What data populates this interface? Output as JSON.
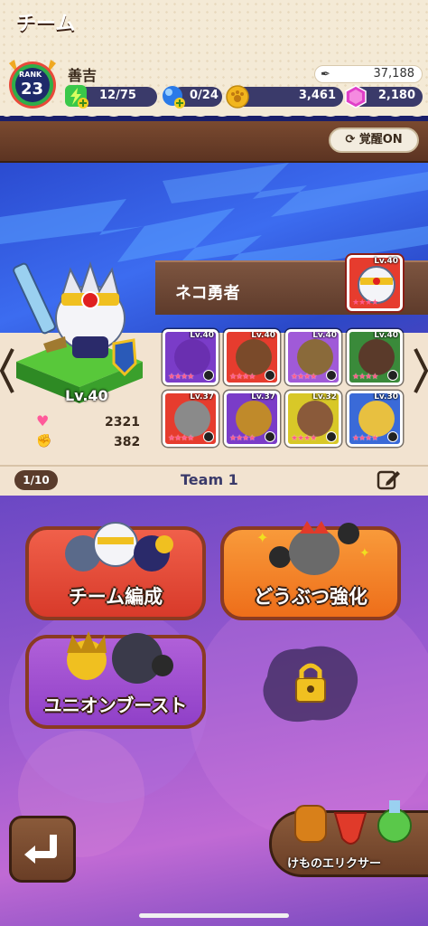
{
  "header": {
    "rank_label": "RANK",
    "rank_value": "23",
    "player_name": "善吉",
    "score": "37,188",
    "stamina": "12/75",
    "orbs": "0/24",
    "coins": "3,461",
    "gems": "2,180"
  },
  "titlebar": {
    "title": "チーム",
    "awake_button": "覚醒ON"
  },
  "leader": {
    "name": "ネコ勇者",
    "level_label": "Lv.40",
    "hp": "2321",
    "attack": "382",
    "card_level": "Lv.40"
  },
  "members": [
    {
      "level": "Lv.40",
      "color": "#7a3cc8",
      "face": "#6a2fb0"
    },
    {
      "level": "Lv.40",
      "color": "#e63c2e",
      "face": "#7a4a2a"
    },
    {
      "level": "Lv.40",
      "color": "#a05ad8",
      "face": "#8a6a3a"
    },
    {
      "level": "Lv.40",
      "color": "#3a8a3a",
      "face": "#5a3a2a"
    },
    {
      "level": "Lv.37",
      "color": "#e63c2e",
      "face": "#8a8a8a"
    },
    {
      "level": "Lv.37",
      "color": "#7a3cc8",
      "face": "#c08a2a"
    },
    {
      "level": "Lv.32",
      "color": "#d8c828",
      "face": "#8a5a3a"
    },
    {
      "level": "Lv.30",
      "color": "#3a6ad8",
      "face": "#e8c040"
    }
  ],
  "team": {
    "page": "1/10",
    "name": "Team 1"
  },
  "menu": {
    "team_edit": "チーム編成",
    "animal_power": "どうぶつ強化",
    "union_boost": "ユニオンブースト",
    "elixir": "けものエリクサー"
  },
  "colors": {
    "red_button": "#e84a3a",
    "orange_button": "#f07a1e",
    "purple_button": "#a050d0",
    "brown": "#5c3422"
  }
}
